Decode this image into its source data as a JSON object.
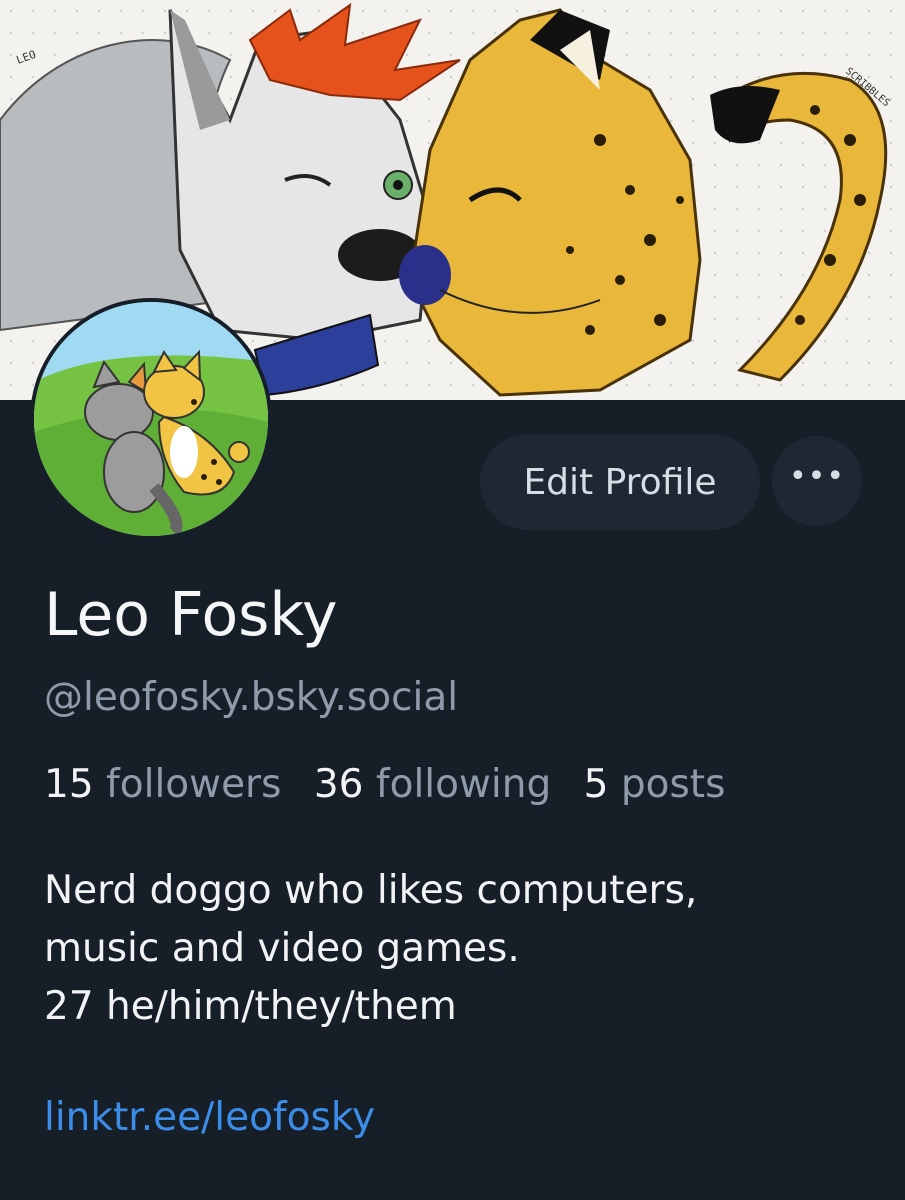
{
  "banner": {
    "signature_left": "LEO",
    "signature_right": "SCRIBBLES"
  },
  "profile": {
    "display_name": "Leo Fosky",
    "handle": "@leofosky.bsky.social",
    "stats": {
      "followers_count": "15",
      "followers_label": "followers",
      "following_count": "36",
      "following_label": "following",
      "posts_count": "5",
      "posts_label": "posts"
    },
    "bio_lines": [
      "Nerd doggo who likes computers,",
      "music and video games.",
      "27 he/him/they/them"
    ],
    "link": "linktr.ee/leofosky"
  },
  "actions": {
    "edit_profile": "Edit Profile",
    "more_icon": "ellipsis-icon"
  },
  "colors": {
    "background": "#161e27",
    "button": "#1e2833",
    "muted": "#8f9bab",
    "link": "#3b8de8"
  }
}
